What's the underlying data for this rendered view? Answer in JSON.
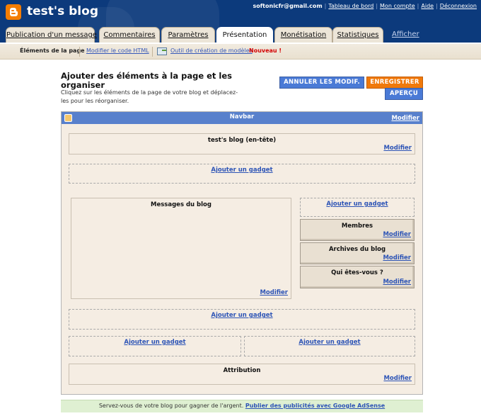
{
  "header": {
    "blog_title": "test's blog",
    "user_email": "softonicfr@gmail.com",
    "links": [
      "Tableau de bord",
      "Mon compte",
      "Aide",
      "Déconnexion"
    ]
  },
  "tabs": [
    "Publication d'un message",
    "Commentaires",
    "Paramètres",
    "Présentation",
    "Monétisation",
    "Statistiques"
  ],
  "active_tab": "Présentation",
  "view_blog_link": "Afficher le blog",
  "subnav": {
    "current": "Éléments de la page",
    "edit_html": "Modifier le code HTML",
    "template_tool": "Outil de création de modèles",
    "new_badge": "Nouveau !"
  },
  "main": {
    "heading": "Ajouter des éléments à la page et les organiser",
    "description": "Cliquez sur les éléments de la page de votre blog et déplacez-les pour les réorganiser.",
    "cancel_button": "ANNULER LES MODIF.",
    "save_button": "ENREGISTRER",
    "preview_button": "APERÇU"
  },
  "layout": {
    "navbar_label": "Navbar",
    "modify_label": "Modifier",
    "add_gadget_label": "Ajouter un gadget",
    "header_block": "test's blog (en-tête)",
    "blog_posts": "Messages du blog",
    "sidebar_gadgets": [
      "Membres",
      "Archives du blog",
      "Qui êtes-vous ?"
    ],
    "attribution": "Attribution"
  },
  "footer": {
    "adsense_text": "Servez-vous de votre blog pour gagner de l'argent.",
    "adsense_link": "Publier des publicités avec Google AdSense"
  },
  "colors": {
    "header_bg": "#0c3a7c",
    "accent_orange": "#f0790a",
    "button_blue": "#4a7ad6",
    "navbar_blue": "#5880cc",
    "link_blue": "#2d54b6",
    "layout_bg": "#f5ede3"
  }
}
